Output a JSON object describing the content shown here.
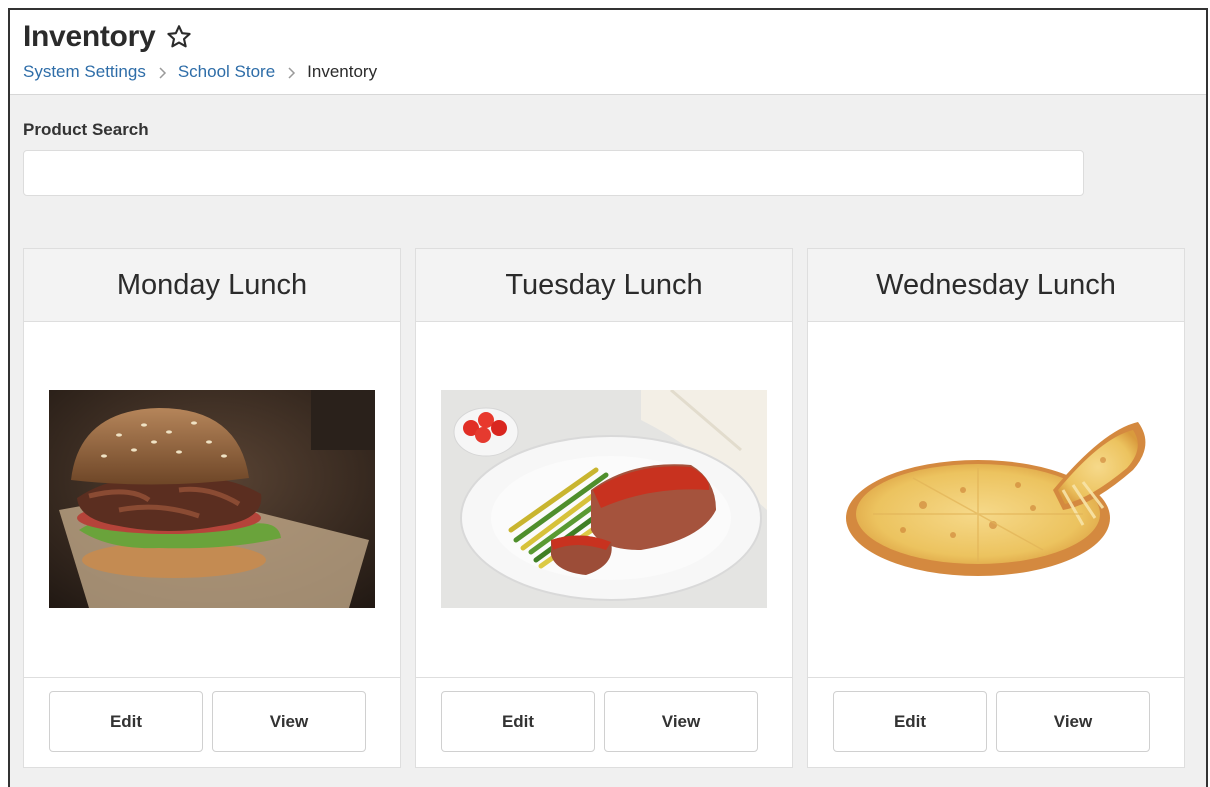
{
  "header": {
    "title": "Inventory",
    "favorite_icon": "star-outline-icon",
    "breadcrumb": [
      {
        "label": "System Settings"
      },
      {
        "label": "School Store"
      },
      {
        "label": "Inventory"
      }
    ]
  },
  "search": {
    "label": "Product Search",
    "value": "",
    "placeholder": ""
  },
  "products": [
    {
      "name": "Monday Lunch",
      "image": "pulled-pork-sandwich-image",
      "edit_label": "Edit",
      "view_label": "View"
    },
    {
      "name": "Tuesday Lunch",
      "image": "meatloaf-plate-image",
      "edit_label": "Edit",
      "view_label": "View"
    },
    {
      "name": "Wednesday Lunch",
      "image": "cheese-pizza-image",
      "edit_label": "Edit",
      "view_label": "View"
    }
  ],
  "colors": {
    "link": "#2e6da8",
    "background": "#f0f0f0",
    "card_header": "#f3f3f3"
  }
}
